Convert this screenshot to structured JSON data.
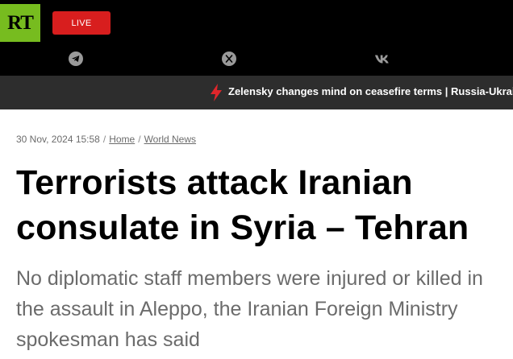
{
  "header": {
    "logo_text": "RT",
    "live_label": "LIVE",
    "social_icons": [
      "telegram-icon",
      "x-icon",
      "vk-icon"
    ],
    "colors": {
      "logo_bg": "#77bc1f",
      "live_bg": "#d81e1e",
      "topbar_bg": "#000000"
    }
  },
  "ticker": {
    "icon": "lightning-icon",
    "text": "Zelensky changes mind on ceasefire terms | Russia-Ukraine conflict"
  },
  "article": {
    "date": "30 Nov, 2024 15:58",
    "breadcrumbs": [
      "Home",
      "World News"
    ],
    "title": "Terrorists attack Iranian consulate in Syria – Tehran",
    "summary": "No diplomatic staff members were injured or killed in the assault in Aleppo, the Iranian Foreign Ministry spokesman has said"
  }
}
